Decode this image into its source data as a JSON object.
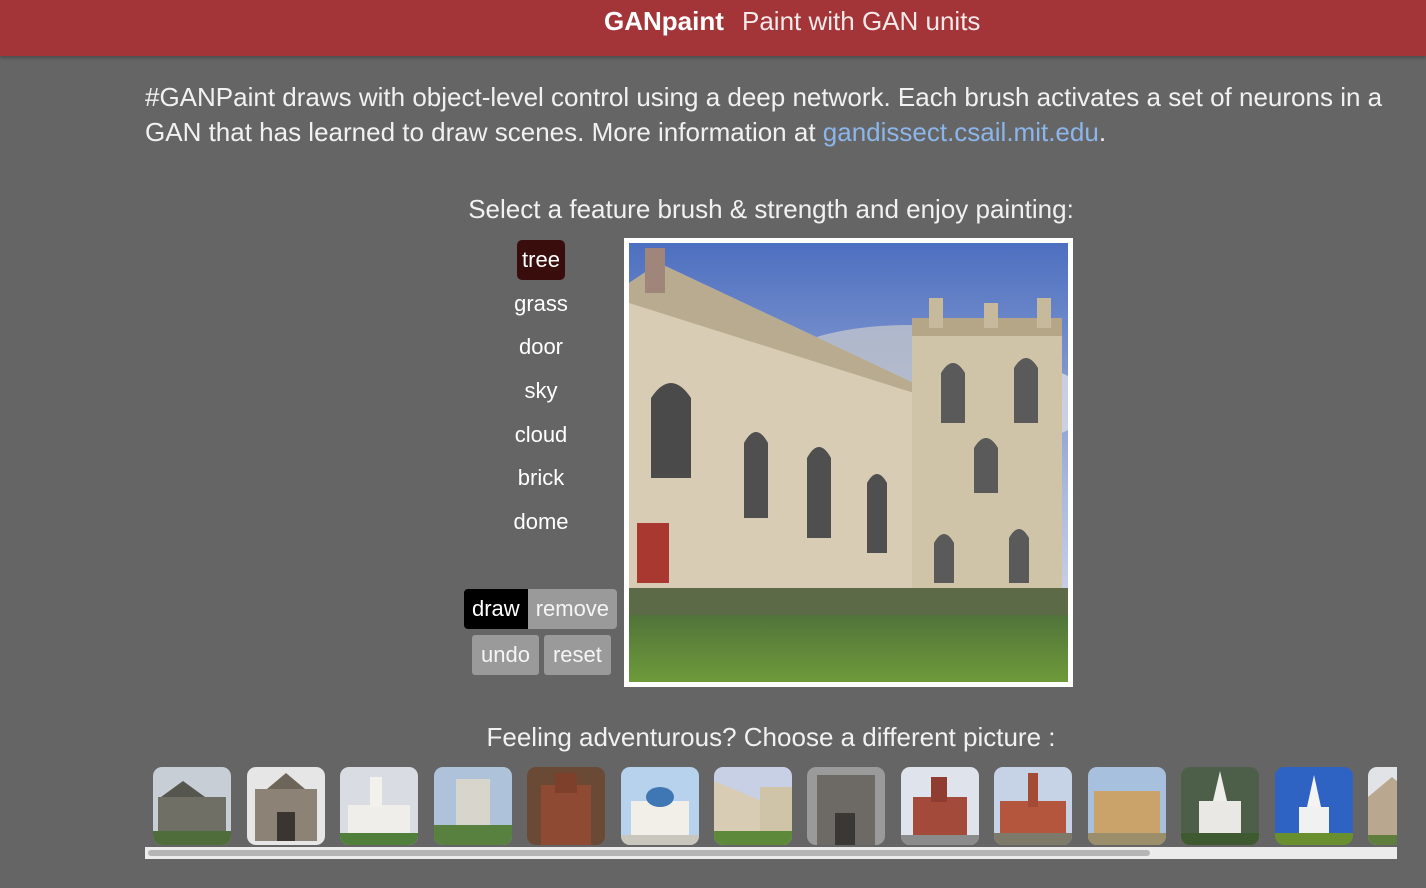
{
  "header": {
    "brand": "GANpaint",
    "tagline": "Paint with GAN units"
  },
  "intro": {
    "text": "#GANPaint draws with object-level control using a deep network. Each brush activates a set of neurons in a GAN that has learned to draw scenes. More information at ",
    "link_text": "gandissect.csail.mit.edu",
    "suffix": "."
  },
  "brush_section": {
    "title": "Select a feature brush & strength and enjoy painting:",
    "brushes": [
      {
        "label": "tree",
        "selected": true
      },
      {
        "label": "grass"
      },
      {
        "label": "door"
      },
      {
        "label": "sky"
      },
      {
        "label": "cloud"
      },
      {
        "label": "brick"
      },
      {
        "label": "dome"
      }
    ],
    "modes": {
      "draw": "draw",
      "remove": "remove",
      "active": "draw"
    },
    "actions": {
      "undo": "undo",
      "reset": "reset"
    }
  },
  "gallery": {
    "title": "Feeling adventurous? Choose a different picture :",
    "thumb_count": 14
  },
  "colors": {
    "header_bg": "#a33437",
    "page_bg": "#656565",
    "link": "#8cb6ea",
    "selected_brush": "#3a0d0d",
    "button_gray": "#9a9a9a"
  }
}
